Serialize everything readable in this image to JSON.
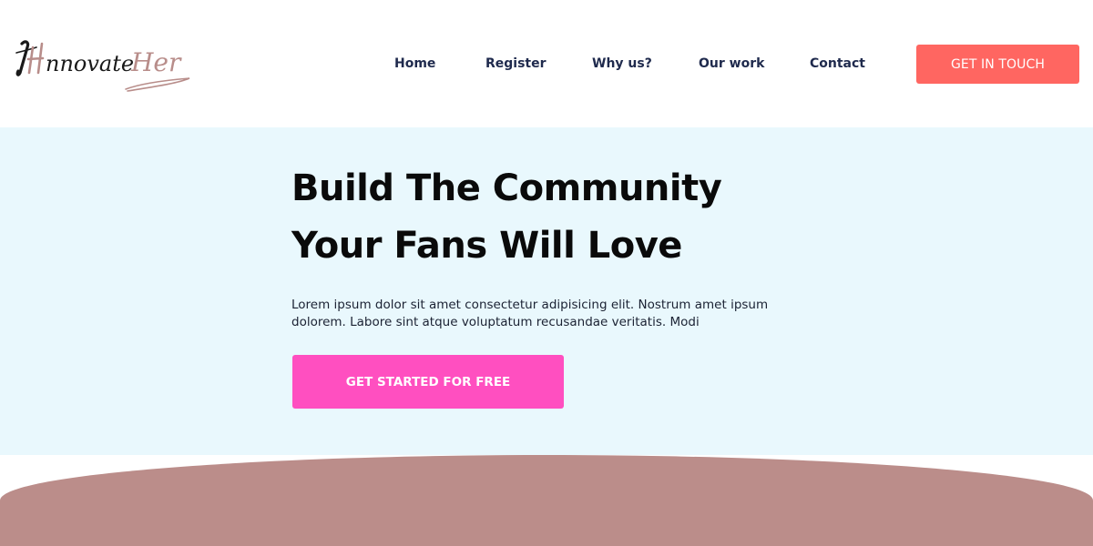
{
  "brand": {
    "logo_text": "InnovateHer",
    "colors": {
      "logo_dark": "#1a1a1a",
      "logo_mauve": "#b88d8a",
      "nav_text": "#1f2a4d",
      "cta_top": "#ff6661",
      "cta_hero": "#ff4fc0",
      "hero_bg": "#e9f8fd",
      "bottom_shape": "#bb8d8a"
    }
  },
  "nav": {
    "items": [
      {
        "label": "Home"
      },
      {
        "label": "Register"
      },
      {
        "label": "Why us?"
      },
      {
        "label": "Our work"
      },
      {
        "label": "Contact"
      }
    ],
    "cta_label": "GET IN TOUCH"
  },
  "hero": {
    "title_line1": "Build The Community",
    "title_line2": "Your Fans Will Love",
    "body": "Lorem ipsum dolor sit amet consectetur adipisicing elit. Nostrum amet ipsum dolorem. Labore sint atque voluptatum recusandae veritatis. Modi",
    "cta_label": "GET STARTED FOR FREE"
  }
}
